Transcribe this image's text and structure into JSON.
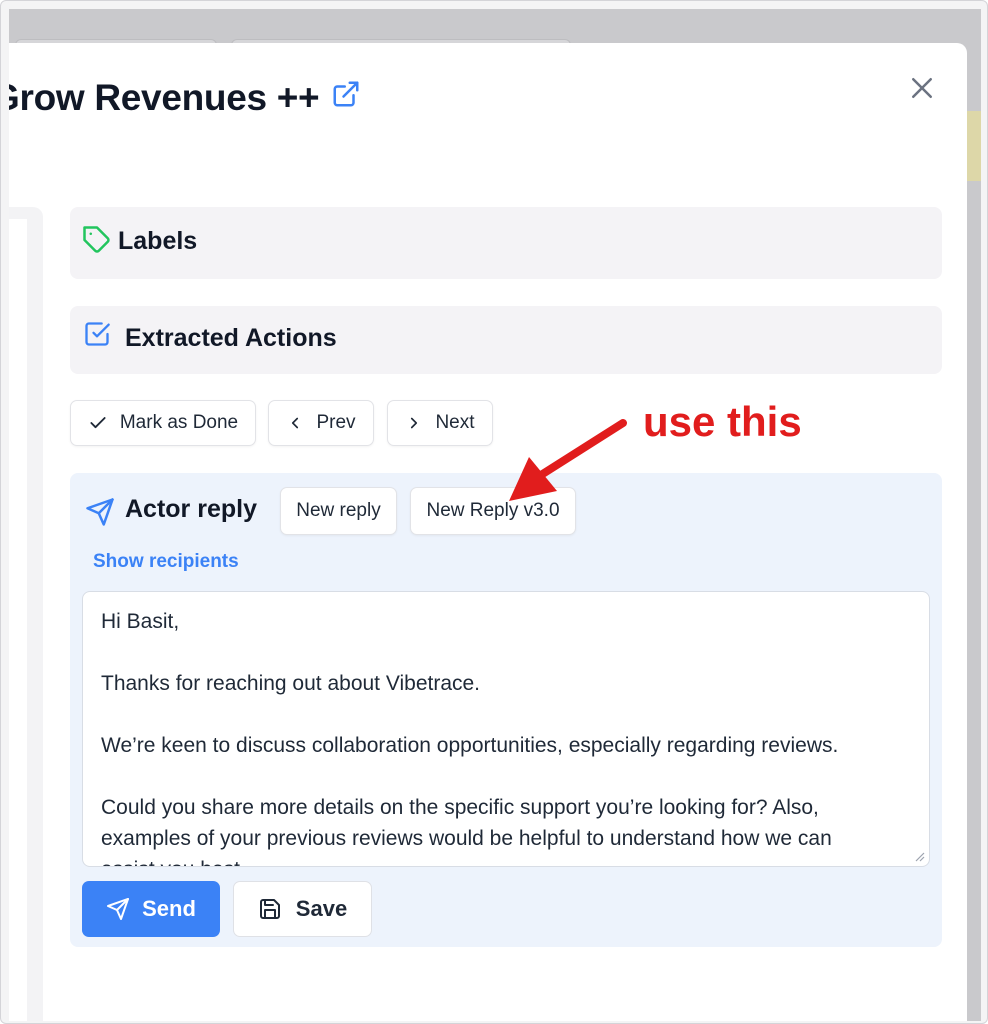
{
  "modal": {
    "title": "Grow Revenues ++",
    "icons": {
      "external": "external-link-icon",
      "close": "close-icon"
    }
  },
  "sections": {
    "labels": {
      "title": "Labels",
      "icon": "tag-icon",
      "icon_color": "#22c55e"
    },
    "extracted_actions": {
      "title": "Extracted Actions",
      "icon": "checkbox-icon",
      "icon_color": "#3b82f6"
    }
  },
  "toolbar": {
    "mark_done": "Mark as Done",
    "prev": "Prev",
    "next": "Next"
  },
  "reply": {
    "title": "Actor reply",
    "new_reply": "New reply",
    "new_reply_v3": "New Reply v3.0",
    "show_recipients": "Show recipients",
    "body_lines": [
      "Hi Basit,",
      "",
      "Thanks for reaching out about Vibetrace.",
      "",
      "We’re keen to discuss collaboration opportunities, especially regarding reviews.",
      "",
      "Could you share more details on the specific support you’re looking for? Also,",
      "examples of your previous reviews would be helpful to understand how we can",
      "assist you best."
    ],
    "send": "Send",
    "save": "Save"
  },
  "annotation": {
    "text": "use this",
    "color": "#e11d1d"
  },
  "colors": {
    "accent": "#3b82f6",
    "reply_bg": "#edf3fc",
    "section_bg": "#f4f3f6"
  }
}
